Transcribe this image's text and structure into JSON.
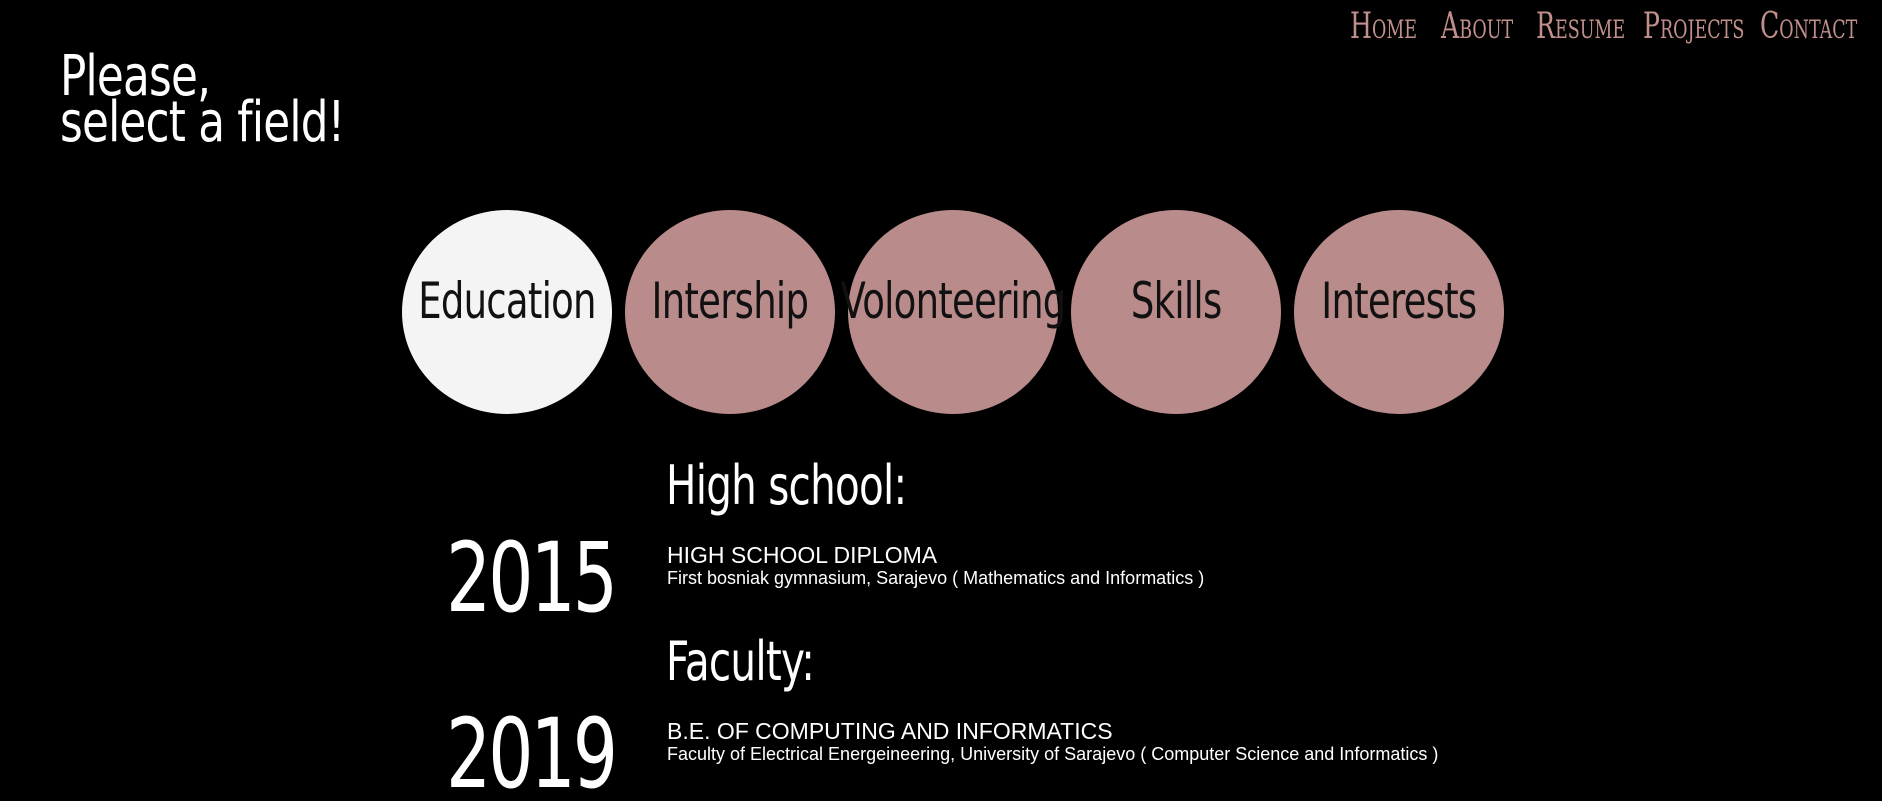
{
  "nav": {
    "items": [
      "Home",
      "About",
      "Resume",
      "Projects",
      "Contact"
    ]
  },
  "headline": {
    "line1": "Please,",
    "line2": "select a field!"
  },
  "fields": [
    {
      "label": "Education",
      "active": true
    },
    {
      "label": "Intership",
      "active": false
    },
    {
      "label": "Volonteering",
      "active": false
    },
    {
      "label": "Skills",
      "active": false
    },
    {
      "label": "Interests",
      "active": false
    }
  ],
  "timeline": [
    {
      "year": "2015",
      "title": "High school:",
      "degree": "HIGH SCHOOL DIPLOMA",
      "place": "First bosniak gymnasium, Sarajevo ( Mathematics and Informatics )"
    },
    {
      "year": "2019",
      "title": "Faculty:",
      "degree": "B.E. OF COMPUTING AND INFORMATICS",
      "place": "Faculty of Electrical Energeineering, University of Sarajevo ( Computer Science and Informatics )"
    }
  ],
  "colors": {
    "background": "#000000",
    "accent": "#c2908c",
    "circle": "#b98b8b",
    "circle_active": "#f4f4f4"
  }
}
